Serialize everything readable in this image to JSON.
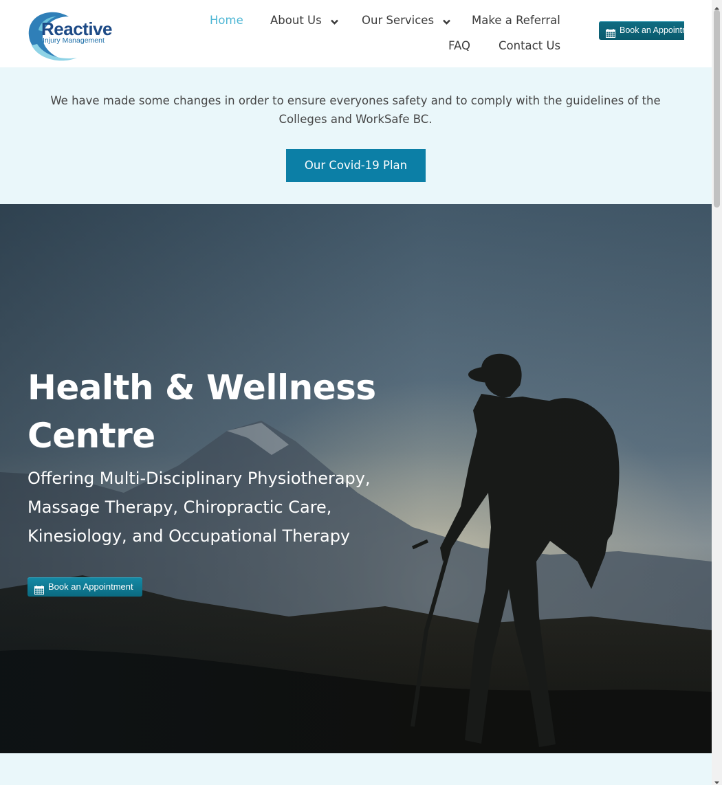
{
  "header": {
    "logo": {
      "main": "Reactive",
      "sub": "Injury Management"
    },
    "nav": {
      "home": "Home",
      "about": "About Us",
      "services": "Our Services",
      "referral": "Make a Referral",
      "faq": "FAQ",
      "contact": "Contact Us"
    },
    "book_label": "Book an Appointment",
    "icons": {
      "calendar": "calendar-icon",
      "chevron": "chevron-down-icon"
    }
  },
  "notice": {
    "text": "We have made some changes in order to ensure everyones safety and to comply with the guidelines of the Colleges and WorkSafe BC.",
    "button": "Our Covid-19 Plan"
  },
  "hero": {
    "title": "Health & Wellness Centre",
    "subtitle": "Offering Multi-Disciplinary Physiotherapy, Massage Therapy, Chiropractic Care, Kinesiology, and Occupational Therapy",
    "book_label": "Book an Appointment"
  },
  "colors": {
    "accent": "#4db6d4",
    "button": "#0c7fa6",
    "notice_bg": "#eaf7fa",
    "logo_blue": "#1d4a86"
  }
}
